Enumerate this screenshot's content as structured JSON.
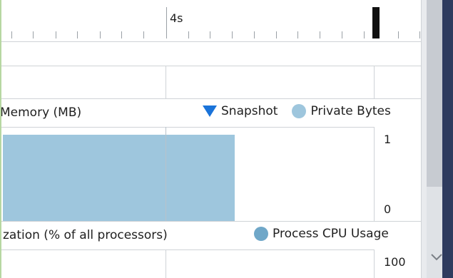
{
  "ruler": {
    "time_label": "4s"
  },
  "memory": {
    "title": "Memory (MB)",
    "legend": {
      "snapshot_label": "Snapshot",
      "private_bytes_label": "Private Bytes"
    },
    "axis": {
      "max_label": "1",
      "min_label": "0"
    },
    "private_bytes_fraction": 0.92
  },
  "cpu": {
    "title": "zation (% of all processors)",
    "legend": {
      "process_cpu_label": "Process CPU Usage"
    },
    "axis": {
      "max_label": "100"
    }
  },
  "icons": {
    "snapshot": "triangle-down-icon",
    "private_bytes": "circle-icon",
    "process_cpu": "circle-icon",
    "scroll_down": "chevron-down-icon"
  },
  "colors": {
    "snapshot_marker": "#1a73d9",
    "private_bytes": "#9ec6dd",
    "process_cpu": "#6fa7c8",
    "accent_left": "#b7d7a2"
  }
}
